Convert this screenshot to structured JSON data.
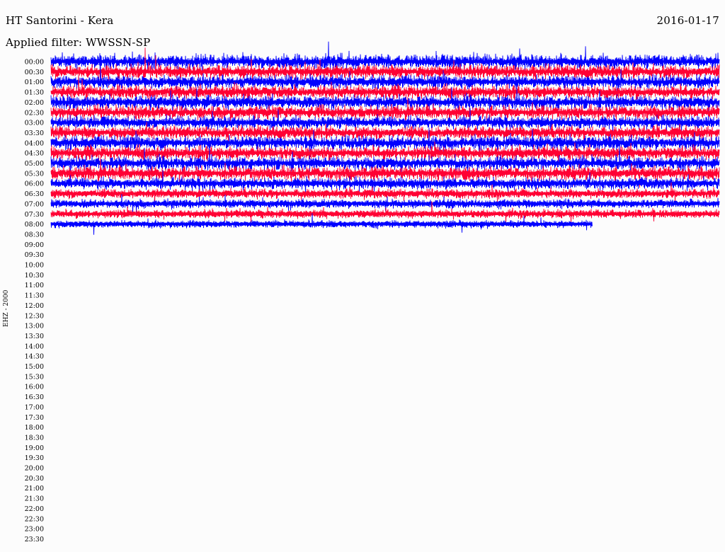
{
  "header": {
    "title": "HT Santorini - Kera",
    "date": "2016-01-17",
    "filter": "Applied filter: WWSSN-SP"
  },
  "axis": {
    "channel_label": "EHZ - 2000"
  },
  "chart_data": {
    "type": "line",
    "title": "HT Santorini - Kera",
    "subtitle": "Applied filter: WWSSN-SP",
    "date": "2016-01-17",
    "ylabel": "EHZ - 2000",
    "y_ticks": [
      "00:00",
      "00:30",
      "01:00",
      "01:30",
      "02:00",
      "02:30",
      "03:00",
      "03:30",
      "04:00",
      "04:30",
      "05:00",
      "05:30",
      "06:00",
      "06:30",
      "07:00",
      "07:30",
      "08:00",
      "08:30",
      "09:00",
      "09:30",
      "10:00",
      "10:30",
      "11:00",
      "11:30",
      "12:00",
      "12:30",
      "13:00",
      "13:30",
      "14:00",
      "14:30",
      "15:00",
      "15:30",
      "16:00",
      "16:30",
      "17:00",
      "17:30",
      "18:00",
      "18:30",
      "19:00",
      "19:30",
      "20:00",
      "20:30",
      "21:00",
      "21:30",
      "22:00",
      "22:30",
      "23:00",
      "23:30"
    ],
    "trace_colors": [
      "#0000ff",
      "#ff0033"
    ],
    "recorded_traces": [
      {
        "start": "00:00",
        "fraction_recorded": 1.0
      },
      {
        "start": "00:30",
        "fraction_recorded": 1.0
      },
      {
        "start": "01:00",
        "fraction_recorded": 1.0
      },
      {
        "start": "01:30",
        "fraction_recorded": 1.0
      },
      {
        "start": "02:00",
        "fraction_recorded": 1.0
      },
      {
        "start": "02:30",
        "fraction_recorded": 1.0
      },
      {
        "start": "03:00",
        "fraction_recorded": 1.0
      },
      {
        "start": "03:30",
        "fraction_recorded": 1.0
      },
      {
        "start": "04:00",
        "fraction_recorded": 1.0
      },
      {
        "start": "04:30",
        "fraction_recorded": 1.0
      },
      {
        "start": "05:00",
        "fraction_recorded": 1.0
      },
      {
        "start": "05:30",
        "fraction_recorded": 1.0
      },
      {
        "start": "06:00",
        "fraction_recorded": 1.0
      },
      {
        "start": "06:30",
        "fraction_recorded": 1.0
      },
      {
        "start": "07:00",
        "fraction_recorded": 1.0
      },
      {
        "start": "07:30",
        "fraction_recorded": 1.0
      },
      {
        "start": "08:00",
        "fraction_recorded": 0.81
      }
    ],
    "trace_amplitude": [
      1.45,
      1.35,
      1.3,
      1.25,
      1.3,
      1.3,
      1.2,
      1.25,
      1.35,
      1.25,
      1.3,
      1.35,
      1.1,
      0.85,
      0.75,
      0.7,
      0.6
    ]
  }
}
